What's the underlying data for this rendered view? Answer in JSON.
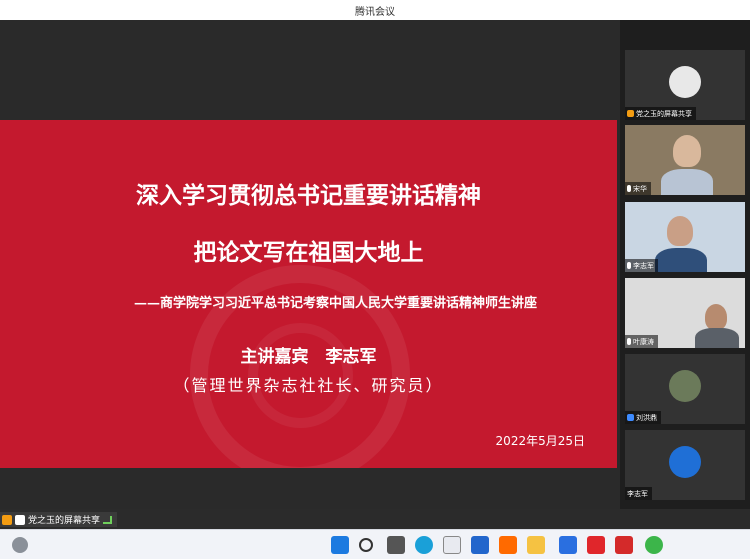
{
  "window": {
    "title": "腾讯会议"
  },
  "slide": {
    "title_line1": "深入学习贯彻总书记重要讲话精神",
    "title_line2": "把论文写在祖国大地上",
    "subtitle": "——商学院学习习近平总书记考察中国人民大学重要讲话精神师生讲座",
    "speaker_line": "主讲嘉宾　李志军",
    "speaker_role": "（管理世界杂志社社长、研究员）",
    "date": "2022年5月25日"
  },
  "share_label": "党之玉的屏幕共享",
  "participants": [
    {
      "name": "党之玉的屏幕共享",
      "kind": "avatar"
    },
    {
      "name": "宋华",
      "kind": "video"
    },
    {
      "name": "李志军",
      "kind": "video"
    },
    {
      "name": "叶康涛",
      "kind": "video"
    },
    {
      "name": "刘洪鼎",
      "kind": "avatar"
    },
    {
      "name": "李志军",
      "kind": "logo"
    }
  ],
  "colors": {
    "slide_red": "#c4192e",
    "taskbar": "#f1f3f8",
    "sidebar": "#1e1e1e"
  },
  "taskbar": {
    "icons": [
      "windows-start-icon",
      "search-icon",
      "task-view-icon",
      "edge-icon",
      "store-icon",
      "mail-icon",
      "xiaomi-icon",
      "file-explorer-icon",
      "tencent-meeting-icon",
      "app-red-icon",
      "wps-icon",
      "wechat-icon"
    ]
  }
}
